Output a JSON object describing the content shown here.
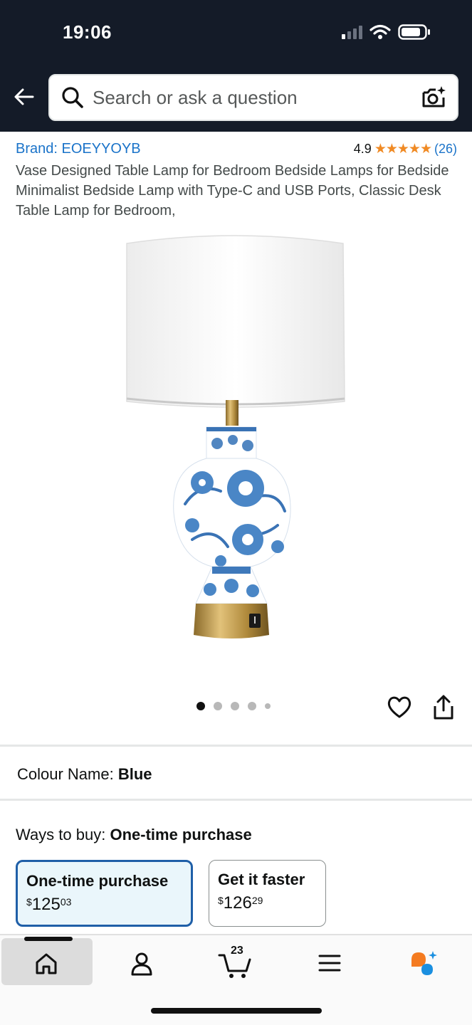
{
  "status_bar": {
    "time": "19:06"
  },
  "header": {
    "search_placeholder": "Search or ask a question"
  },
  "product": {
    "brand": "Brand: EOEYYOYB",
    "rating": "4.9",
    "stars": "★★★★★",
    "review_count": "(26)",
    "title": "Vase Designed Table Lamp for Bedroom Bedside Lamps for Bedside Minimalist Bedside Lamp with Type-C and USB Ports, Classic Desk Table Lamp for Bedroom,",
    "image_count": 5,
    "active_image": 1
  },
  "colour": {
    "label": "Colour Name: ",
    "value": "Blue"
  },
  "ways_to_buy": {
    "label": "Ways to buy: ",
    "selected": "One-time purchase",
    "options": [
      {
        "label": "One-time purchase",
        "currency": "$",
        "whole": "125",
        "cents": "03"
      },
      {
        "label": "Get it faster",
        "currency": "$",
        "whole": "126",
        "cents": "29"
      }
    ]
  },
  "bottom_nav": {
    "cart_count": "23"
  },
  "colors": {
    "header_bg": "#141b28",
    "link": "#1a73c9",
    "star": "#f08a24",
    "selected_border": "#1f5fa8"
  }
}
